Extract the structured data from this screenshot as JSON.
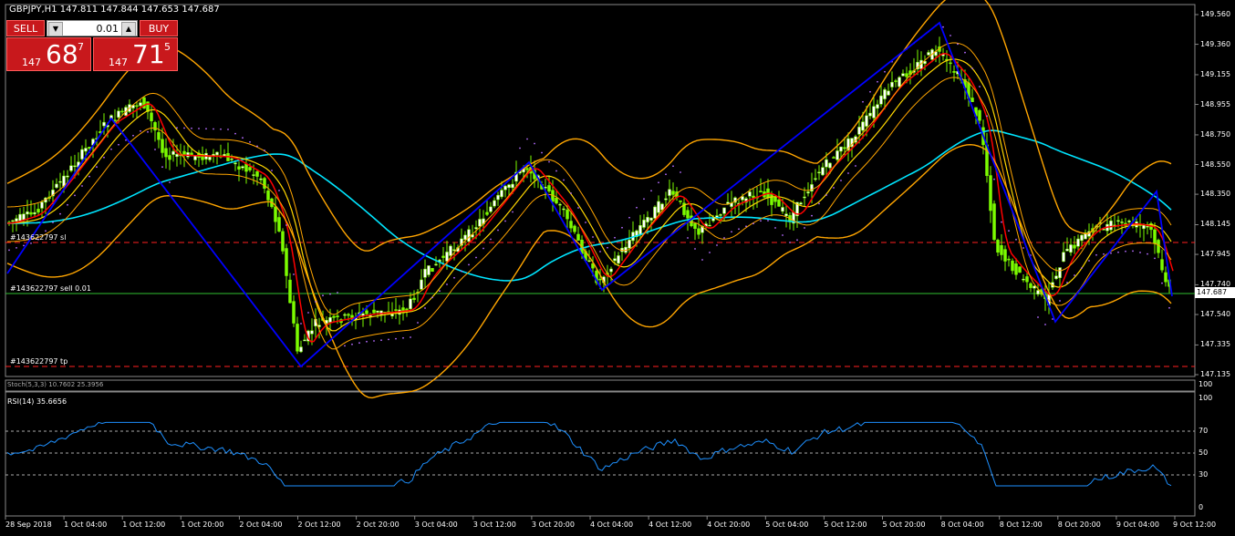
{
  "symbol_info": "GBPJPY,H1  147.811 147.844 147.653 147.687",
  "trade_panel": {
    "sell_label": "SELL",
    "buy_label": "BUY",
    "lot_value": "0.01",
    "sell_price": {
      "small": "147",
      "big": "68",
      "sup": "7"
    },
    "buy_price": {
      "small": "147",
      "big": "71",
      "sup": "5"
    }
  },
  "price_axis": [
    {
      "label": "149.560",
      "value": 149.56
    },
    {
      "label": "149.360",
      "value": 149.36
    },
    {
      "label": "149.155",
      "value": 149.155
    },
    {
      "label": "148.955",
      "value": 148.955
    },
    {
      "label": "148.750",
      "value": 148.75
    },
    {
      "label": "148.550",
      "value": 148.55
    },
    {
      "label": "148.350",
      "value": 148.35
    },
    {
      "label": "148.145",
      "value": 148.145
    },
    {
      "label": "147.945",
      "value": 147.945
    },
    {
      "label": "147.740",
      "value": 147.74
    },
    {
      "label": "147.540",
      "value": 147.54
    },
    {
      "label": "147.335",
      "value": 147.335
    },
    {
      "label": "147.135",
      "value": 147.135
    }
  ],
  "current_price": "147.687",
  "orders": {
    "sl_label": "#143622797 sl",
    "entry_label": "#143622797 sell 0.01",
    "tp_label": "#143622797 tp"
  },
  "time_axis": [
    "28 Sep 2018",
    "1 Oct 04:00",
    "1 Oct 12:00",
    "1 Oct 20:00",
    "2 Oct 04:00",
    "2 Oct 12:00",
    "2 Oct 20:00",
    "3 Oct 04:00",
    "3 Oct 12:00",
    "3 Oct 20:00",
    "4 Oct 04:00",
    "4 Oct 12:00",
    "4 Oct 20:00",
    "5 Oct 04:00",
    "5 Oct 12:00",
    "5 Oct 20:00",
    "8 Oct 04:00",
    "8 Oct 12:00",
    "8 Oct 20:00",
    "9 Oct 04:00",
    "9 Oct 12:00"
  ],
  "stoch_panel": {
    "label": "Stoch(5,3,3) 10.7602 25.3956",
    "axis_top": "100",
    "axis_bottom": "0"
  },
  "rsi_panel": {
    "label": "RSI(14) 35.6656",
    "axis": [
      "100",
      "70",
      "50",
      "30",
      "0"
    ]
  },
  "colors": {
    "sell": "#c8181c",
    "buy": "#c8181c",
    "zigzag": "#0000ff",
    "ma_fast": "#ff0000",
    "ma_mid": "#ffd700",
    "bands": "#ffa500",
    "ma_slow": "#00e5ff",
    "rsi": "#1e90ff",
    "sar": "#b46cff",
    "bull_candle": "#ffffff",
    "bear_candle": "#7cfc00"
  }
}
